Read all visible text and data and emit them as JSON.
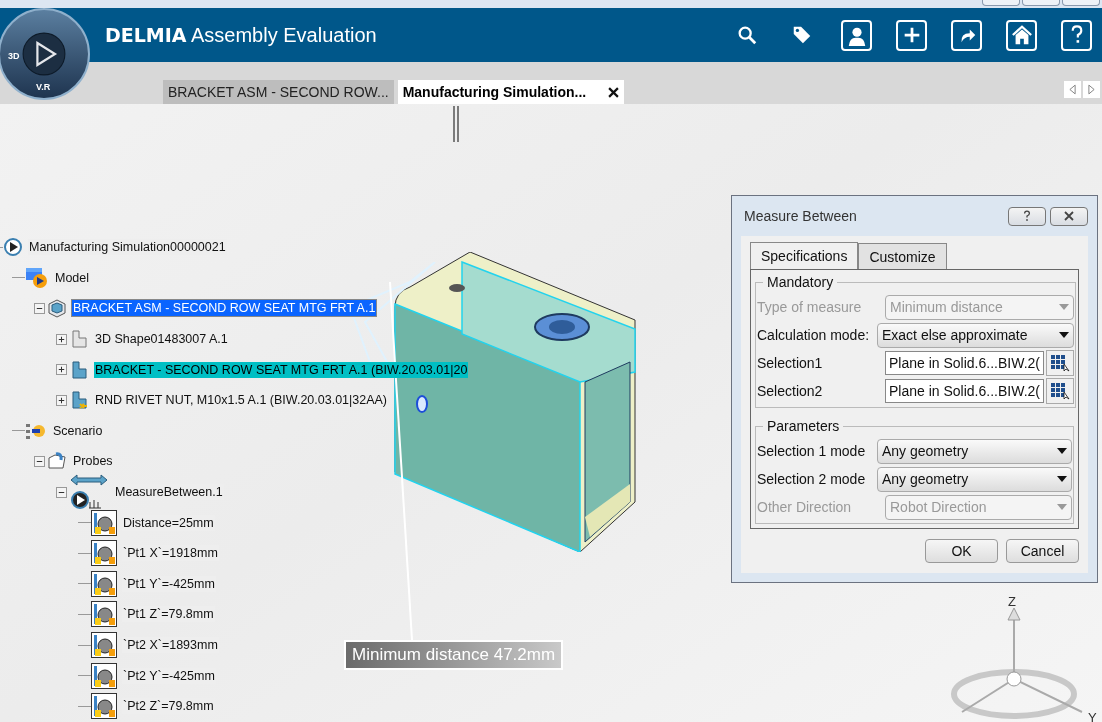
{
  "app": {
    "brand": "DELMIA",
    "title": "Assembly Evaluation",
    "logo_labels": [
      "3D",
      "V.R"
    ]
  },
  "tabs": [
    {
      "label": "BRACKET ASM - SECOND ROW...",
      "selected": false,
      "closable": false
    },
    {
      "label": "Manufacturing Simulation...",
      "selected": true,
      "closable": true
    }
  ],
  "tree": [
    {
      "label": "Manufacturing Simulation00000021",
      "kind": "process",
      "selected": false,
      "preselected": false,
      "children": [
        {
          "label": "Model",
          "kind": "model",
          "selected": false,
          "preselected": false,
          "children": [
            {
              "label": "BRACKET ASM - SECOND ROW SEAT MTG FRT A.1",
              "kind": "product",
              "expanded": true,
              "selected": true,
              "preselected": false,
              "children": [
                {
                  "label": "3D Shape01483007 A.1",
                  "kind": "shape",
                  "expanded": false,
                  "selected": false,
                  "preselected": false
                },
                {
                  "label": "BRACKET - SECOND ROW SEAT MTG FRT A.1 (BIW.20.03.01|20",
                  "kind": "part",
                  "expanded": false,
                  "selected": false,
                  "preselected": true
                },
                {
                  "label": "RND RIVET NUT, M10x1.5 A.1 (BIW.20.03.01|32AA)",
                  "kind": "rivet",
                  "expanded": false,
                  "selected": false,
                  "preselected": false
                }
              ]
            }
          ]
        },
        {
          "label": "Scenario",
          "kind": "scenario",
          "selected": false,
          "preselected": false,
          "children": [
            {
              "label": "Probes",
              "kind": "probes",
              "expanded": true,
              "selected": false,
              "preselected": false,
              "children": [
                {
                  "label": "MeasureBetween.1",
                  "kind": "measure",
                  "expanded": true,
                  "selected": false,
                  "preselected": false,
                  "children": [
                    {
                      "label": "Distance=25mm",
                      "kind": "parameter",
                      "selected": false,
                      "preselected": false
                    },
                    {
                      "label": "`Pt1 X`=1918mm",
                      "kind": "parameter",
                      "selected": false,
                      "preselected": false
                    },
                    {
                      "label": "`Pt1 Y`=-425mm",
                      "kind": "parameter",
                      "selected": false,
                      "preselected": false
                    },
                    {
                      "label": "`Pt1 Z`=79.8mm",
                      "kind": "parameter",
                      "selected": false,
                      "preselected": false
                    },
                    {
                      "label": "`Pt2 X`=1893mm",
                      "kind": "parameter",
                      "selected": false,
                      "preselected": false
                    },
                    {
                      "label": "`Pt2 Y`=-425mm",
                      "kind": "parameter",
                      "selected": false,
                      "preselected": false
                    },
                    {
                      "label": "`Pt2 Z`=79.8mm",
                      "kind": "parameter",
                      "selected": false,
                      "preselected": false
                    }
                  ]
                }
              ]
            }
          ]
        }
      ]
    }
  ],
  "measure_label": "Minimum distance 47.2mm",
  "compass": {
    "axes": [
      "Z",
      "Y"
    ]
  },
  "dialog": {
    "title": "Measure Between",
    "tabs": [
      {
        "label": "Specifications",
        "selected": true
      },
      {
        "label": "Customize",
        "selected": false
      }
    ],
    "groups": [
      {
        "title": "Mandatory",
        "rows": [
          {
            "kind": "dropdown",
            "label": "Type of measure",
            "value": "Minimum distance",
            "disabled": true
          },
          {
            "kind": "dropdown",
            "label": "Calculation mode:",
            "value": "Exact else approximate",
            "disabled": false
          },
          {
            "kind": "selection",
            "label": "Selection1",
            "value": "Plane in Solid.6...BIW.2(",
            "disabled": false
          },
          {
            "kind": "selection",
            "label": "Selection2",
            "value": "Plane in Solid.6...BIW.2(",
            "disabled": false
          }
        ]
      },
      {
        "title": "Parameters",
        "rows": [
          {
            "kind": "dropdown",
            "label": "Selection 1 mode",
            "value": "Any geometry",
            "disabled": false
          },
          {
            "kind": "dropdown",
            "label": "Selection 2 mode",
            "value": "Any geometry",
            "disabled": false
          },
          {
            "kind": "dropdown",
            "label": "Other Direction",
            "value": "Robot Direction",
            "disabled": true
          }
        ]
      }
    ],
    "buttons": [
      "OK",
      "Cancel"
    ]
  }
}
